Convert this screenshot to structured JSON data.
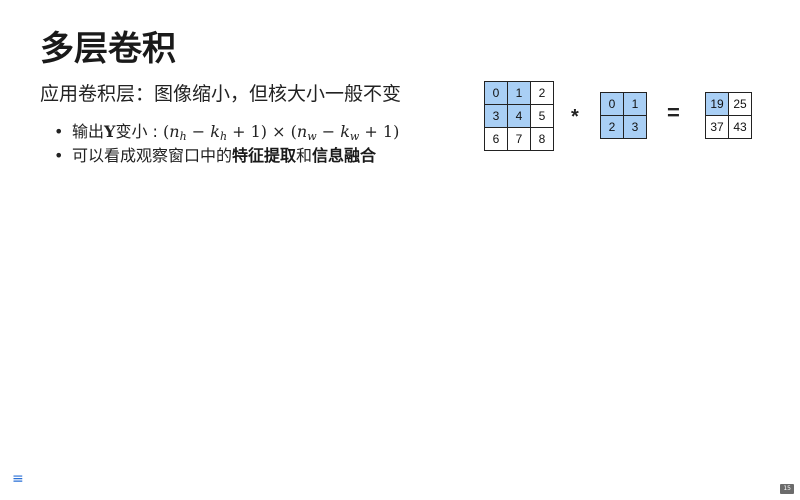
{
  "slide": {
    "title": "多层卷积",
    "subtitle": "应用卷积层：图像缩小，但核大小一般不变",
    "bullets": [
      {
        "prefix": "输出",
        "var": "Y",
        "mid": "变小 : ",
        "formula": {
          "open1": "(",
          "n": "n",
          "sub_h": "h",
          "minus1": " − ",
          "k": "k",
          "sub_h2": "h",
          "plus1": " + 1)",
          "times": " × ",
          "open2": "(",
          "n2": "n",
          "sub_w": "w",
          "minus2": " − ",
          "k2": "k",
          "sub_w2": "w",
          "plus2": " + 1)"
        }
      },
      {
        "text_a": "可以看成观察窗口中的",
        "bold_a": "特征提取",
        "text_b": "和",
        "bold_b": "信息融合"
      }
    ]
  },
  "diagram": {
    "input": [
      "0",
      "1",
      "2",
      "3",
      "4",
      "5",
      "6",
      "7",
      "8"
    ],
    "kernel": [
      "0",
      "1",
      "2",
      "3"
    ],
    "output": [
      "19",
      "25",
      "37",
      "43"
    ],
    "op_star": "*",
    "op_equals": "=",
    "highlight_color": "#a9cff5"
  },
  "footer": {
    "menu_icon": "≡",
    "page_number": "15"
  }
}
